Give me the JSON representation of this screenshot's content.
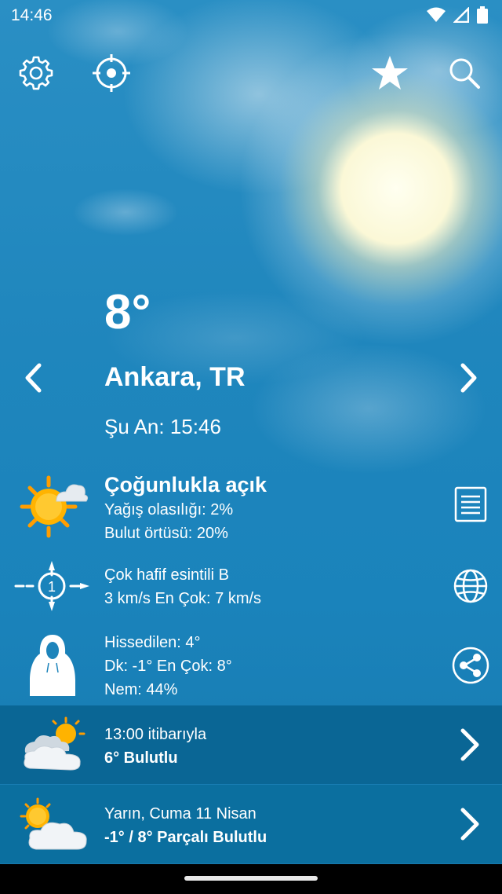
{
  "status_bar": {
    "time": "14:46",
    "icons": [
      "wifi-icon",
      "signal-icon",
      "battery-icon"
    ]
  },
  "toolbar": {
    "icons": [
      "gear-icon",
      "location-target-icon",
      "star-icon",
      "search-icon"
    ]
  },
  "current": {
    "temperature": "8°",
    "city": "Ankara, TR",
    "time_label": "Şu An: 15:46"
  },
  "conditions": {
    "title": "Çoğunlukla açık",
    "precip": "Yağış olasılığı: 2%",
    "cloud": "Bulut örtüsü: 20%"
  },
  "wind": {
    "description": "Çok hafif esintili B",
    "speed": "3 km/s En Çok: 7 km/s",
    "beaufort": "1"
  },
  "feels": {
    "feels_like": "Hissedilen: 4°",
    "minmax": "Dk: -1° En Çok: 8°",
    "humidity": "Nem: 44%"
  },
  "forecast": [
    {
      "line1": "13:00 itibarıyla",
      "line2": "6° Bulutlu",
      "icon": "cloudy-sun-icon"
    },
    {
      "line1": "Yarın, Cuma 11 Nisan",
      "line2": "-1° / 8° Parçalı Bulutlu",
      "icon": "partly-cloudy-icon"
    }
  ],
  "colors": {
    "sky": "#1f86bd",
    "band_hourly": "#0a6695",
    "band_tomorrow": "#0b6f9f",
    "sun": "#ffb300"
  }
}
